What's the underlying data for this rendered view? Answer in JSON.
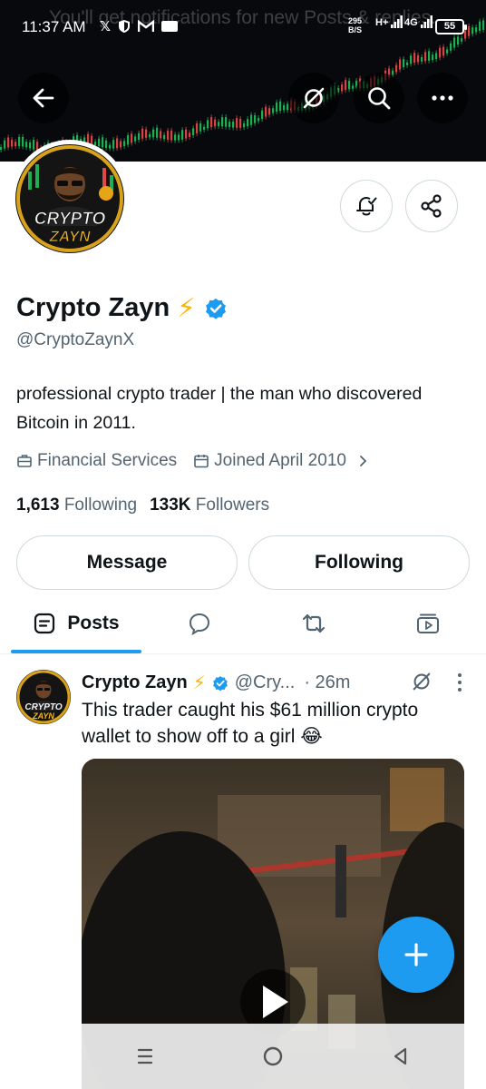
{
  "status_bar": {
    "time": "11:37 AM",
    "net_speed_value": "295",
    "net_speed_unit": "B/S",
    "signal_1": "H+",
    "signal_2": "4G",
    "battery": "55"
  },
  "notification_ghost": "You'll get notifications for new Posts & replies.",
  "header": {
    "back_icon": "arrow-left-icon",
    "grok_icon": "grok-slash-icon",
    "search_icon": "search-icon",
    "more_icon": "more-horizontal-icon"
  },
  "profile": {
    "avatar_text_1": "CRYPTO",
    "avatar_text_2": "ZAYN",
    "name": "Crypto Zayn",
    "emoji": "⚡",
    "handle": "@CryptoZaynX",
    "bio": "professional crypto trader | the man who discovered Bitcoin in 2011.",
    "category": "Financial Services",
    "joined": "Joined April 2010",
    "following_count": "1,613",
    "following_label": "Following",
    "followers_count": "133K",
    "followers_label": "Followers"
  },
  "actions": {
    "message": "Message",
    "following": "Following"
  },
  "tabs": [
    {
      "label": "Posts",
      "icon": "posts-icon"
    },
    {
      "label": "",
      "icon": "reply-bubble-icon"
    },
    {
      "label": "",
      "icon": "repost-icon"
    },
    {
      "label": "",
      "icon": "media-icon"
    }
  ],
  "post": {
    "name": "Crypto Zayn",
    "emoji": "⚡",
    "handle": "@Cry...",
    "time": "· 26m",
    "text": "This trader caught his $61 million crypto wallet to show off to a girl 😂"
  },
  "colors": {
    "accent": "#1d9bf0",
    "text": "#0f1419",
    "secondary": "#536471",
    "border": "#cfd9de"
  }
}
